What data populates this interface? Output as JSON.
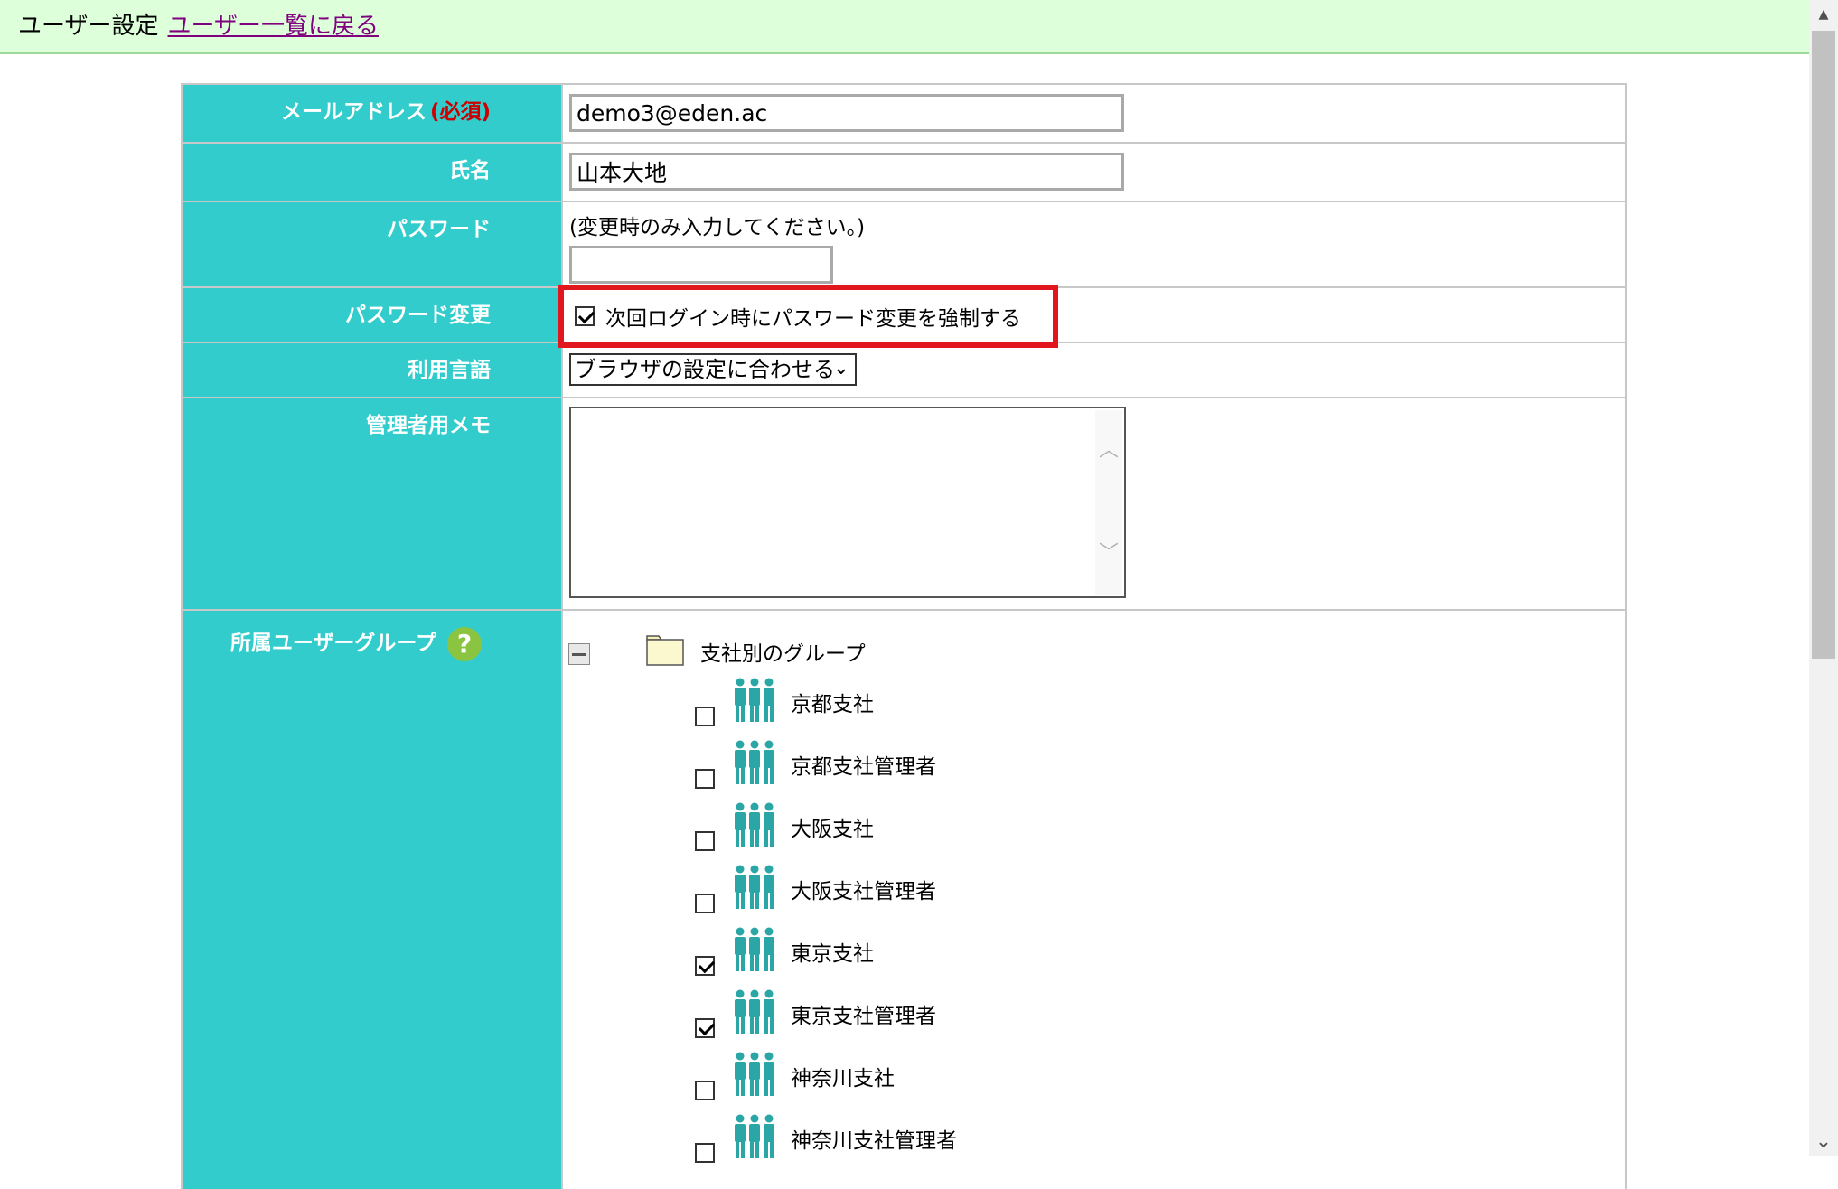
{
  "header": {
    "title": "ユーザー設定",
    "back_link": "ユーザー一覧に戻る"
  },
  "form": {
    "email": {
      "label": "メールアドレス",
      "required": "(必須)",
      "value": "demo3@eden.ac"
    },
    "name": {
      "label": "氏名",
      "value": "山本大地"
    },
    "password": {
      "label": "パスワード",
      "hint": "(変更時のみ入力してください。)",
      "value": ""
    },
    "password_change": {
      "label": "パスワード変更",
      "checkbox_label": "次回ログイン時にパスワード変更を強制する",
      "checked": true
    },
    "language": {
      "label": "利用言語",
      "selected": "ブラウザの設定に合わせる"
    },
    "memo": {
      "label": "管理者用メモ",
      "value": ""
    },
    "groups": {
      "label": "所属ユーザーグループ",
      "help": "?",
      "root": "支社別のグループ",
      "items": [
        {
          "name": "京都支社",
          "checked": false
        },
        {
          "name": "京都支社管理者",
          "checked": false
        },
        {
          "name": "大阪支社",
          "checked": false
        },
        {
          "name": "大阪支社管理者",
          "checked": false
        },
        {
          "name": "東京支社",
          "checked": true
        },
        {
          "name": "東京支社管理者",
          "checked": true
        },
        {
          "name": "神奈川支社",
          "checked": false
        },
        {
          "name": "神奈川支社管理者",
          "checked": false
        }
      ]
    }
  },
  "colors": {
    "header_bg": "#ddffd9",
    "label_bg": "#33cccc",
    "highlight": "#e2161f",
    "link": "#800080",
    "group_icon": "#2aa6a6"
  }
}
